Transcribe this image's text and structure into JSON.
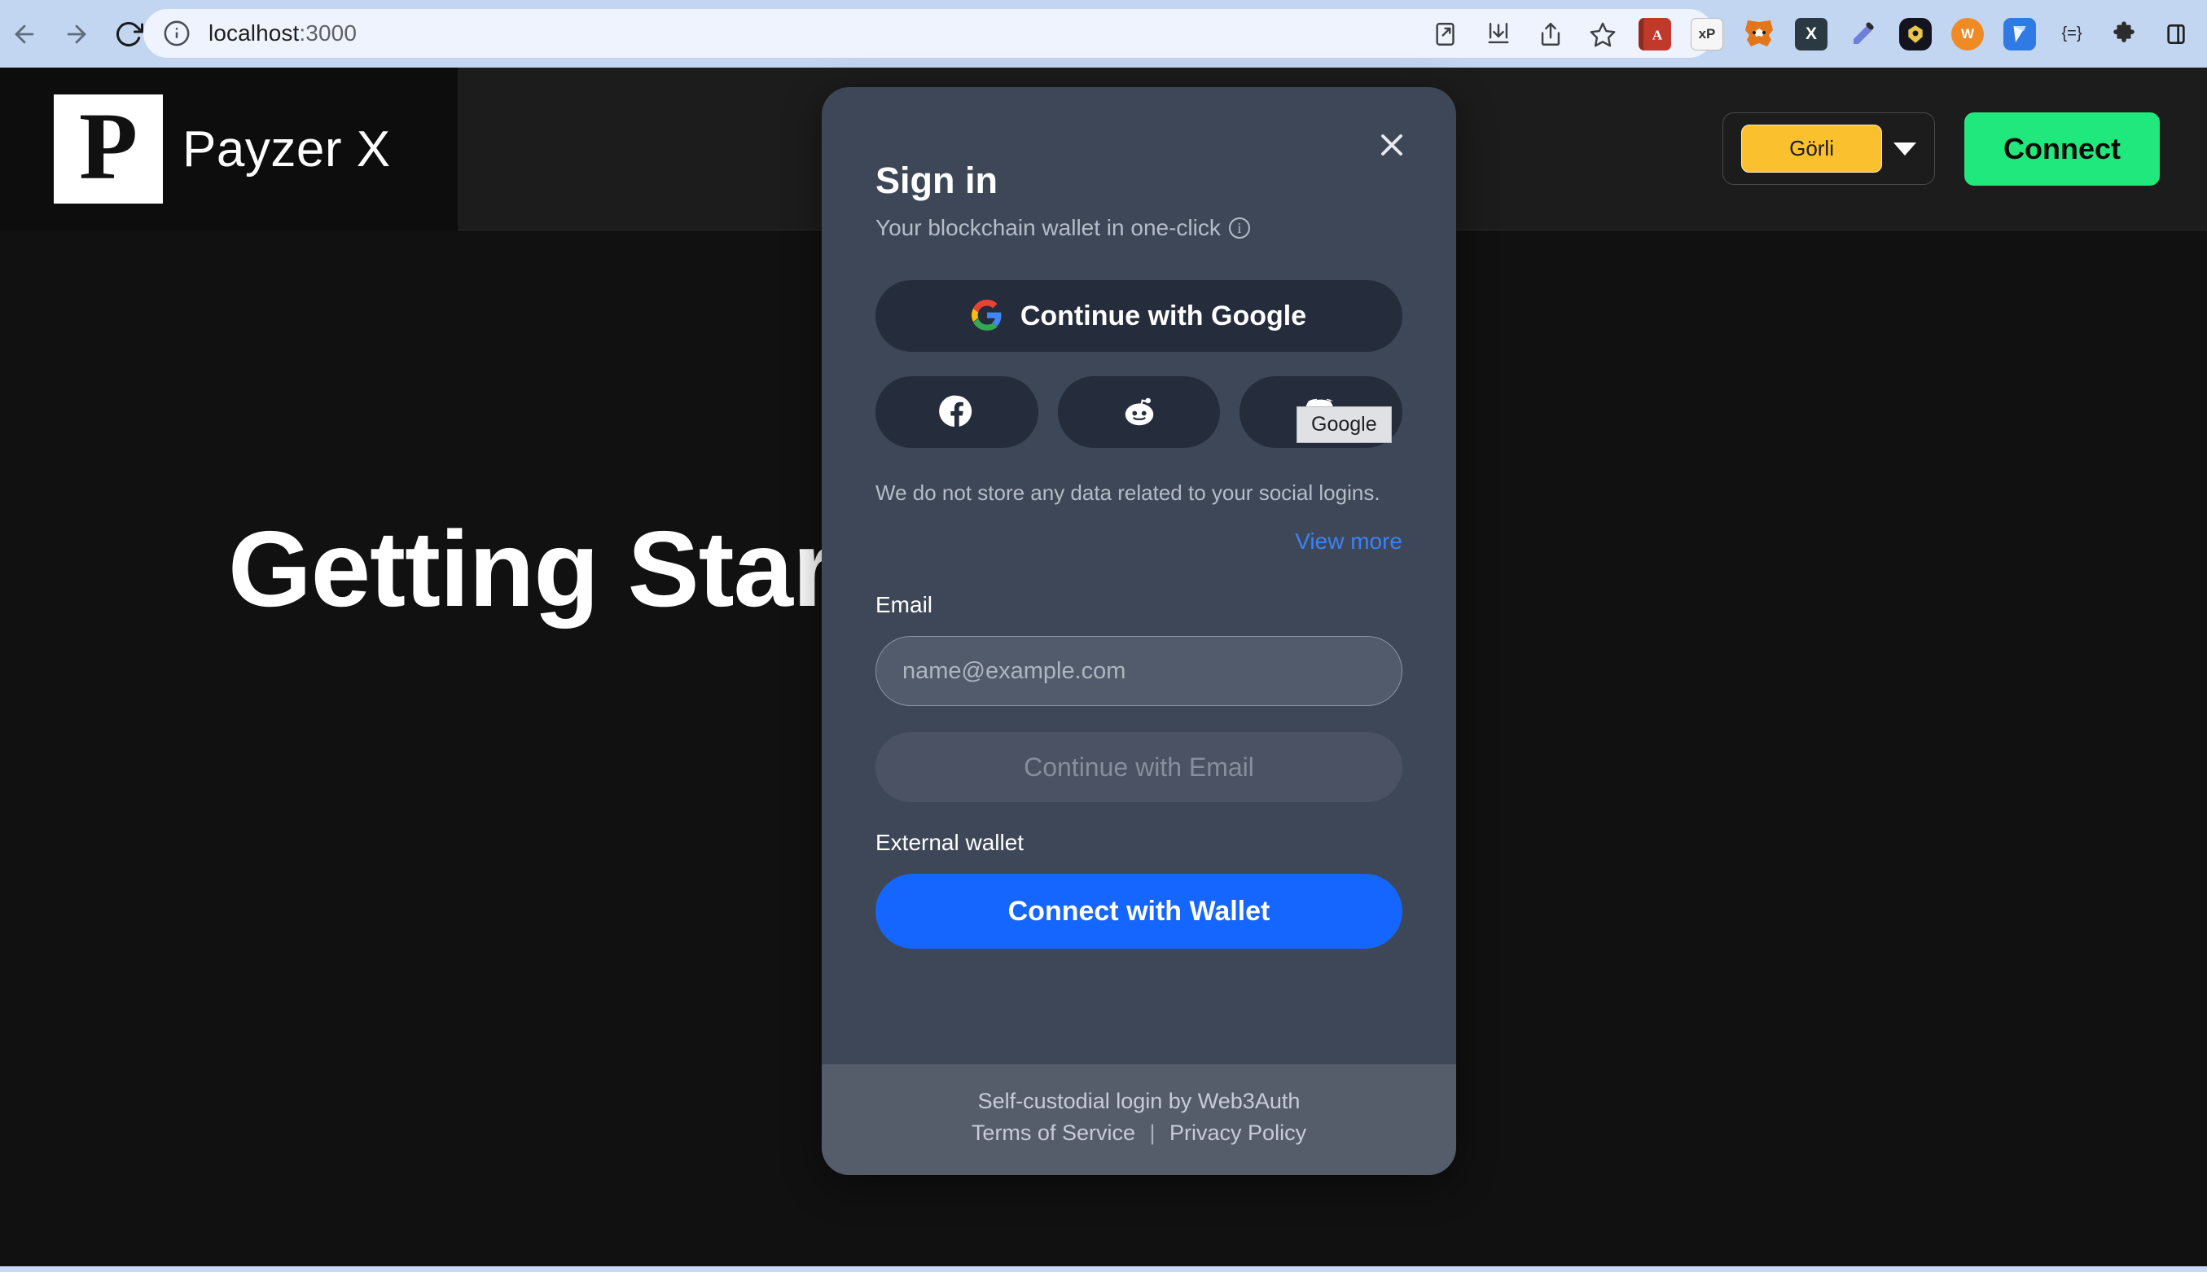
{
  "browser": {
    "nav": {
      "back_label": "Back",
      "forward_label": "Forward",
      "reload_label": "Reload"
    },
    "omnibox": {
      "site_info_icon": "info-circle-icon",
      "url_host": "localhost",
      "url_port": ":3000"
    },
    "actions": [
      {
        "name": "open-in-new-icon",
        "glyph": "open-in-new"
      },
      {
        "name": "install-app-icon",
        "glyph": "install"
      },
      {
        "name": "share-icon",
        "glyph": "share"
      },
      {
        "name": "bookmark-star-icon",
        "glyph": "star"
      }
    ],
    "extensions": [
      {
        "name": "ext-red-book-icon",
        "label": "A",
        "color": "#c0392b"
      },
      {
        "name": "ext-xp-document-icon",
        "label": "xP",
        "color": "#f2f2f2"
      },
      {
        "name": "ext-metamask-icon",
        "label": "M",
        "color": "#e2761b"
      },
      {
        "name": "ext-x-icon",
        "label": "X",
        "color": "#2b3a42"
      },
      {
        "name": "ext-eyedropper-icon",
        "label": "/",
        "color": "#5b6dd8"
      },
      {
        "name": "ext-rabby-icon",
        "label": "R",
        "color": "#1c1c2e"
      },
      {
        "name": "ext-orange-wallet-icon",
        "label": "W",
        "color": "#f08a24"
      },
      {
        "name": "ext-blue-arrow-icon",
        "label": "N",
        "color": "#2f7ae5"
      },
      {
        "name": "ext-code-braces-icon",
        "label": "{=}",
        "color": "#1f1f1f"
      },
      {
        "name": "ext-puzzle-icon",
        "label": "P",
        "color": "#2a2a2a"
      },
      {
        "name": "ext-side-panel-icon",
        "label": "S",
        "color": "#1f1f1f"
      }
    ]
  },
  "site": {
    "brand": {
      "mark_letter": "P",
      "name": "Payzer X"
    },
    "network_selector": {
      "value": "Görli",
      "caret_icon": "chevron-down-icon"
    },
    "connect_button": "Connect",
    "hero_title": "Getting Started"
  },
  "modal": {
    "close_icon": "close-icon",
    "title": "Sign in",
    "subtitle": "Your blockchain wallet in one-click",
    "subtitle_info_icon": "info-icon",
    "google_button": {
      "label": "Continue with Google",
      "icon": "google-icon"
    },
    "social_buttons": [
      {
        "label": "Facebook",
        "icon": "facebook-icon"
      },
      {
        "label": "Reddit",
        "icon": "reddit-icon"
      },
      {
        "label": "Discord",
        "icon": "discord-icon"
      }
    ],
    "disclaimer": "We do not store any data related to your social logins.",
    "view_more": "View more",
    "email_label": "Email",
    "email_value": "",
    "email_placeholder": "name@example.com",
    "email_submit": "Continue with Email",
    "external_wallet_label": "External wallet",
    "wallet_button": "Connect with Wallet",
    "footer": {
      "provider": "Self-custodial login by Web3Auth",
      "terms": "Terms of Service",
      "separator": "|",
      "privacy": "Privacy Policy"
    }
  },
  "tooltip": {
    "text": "Google"
  },
  "colors": {
    "accent_green": "#20e87c",
    "accent_blue": "#1565ff",
    "link_blue": "#3b82f6",
    "network_yellow": "#fbc02d",
    "modal_bg": "#3e4758",
    "modal_footer_bg": "#555d6b",
    "page_bg": "#111111"
  }
}
